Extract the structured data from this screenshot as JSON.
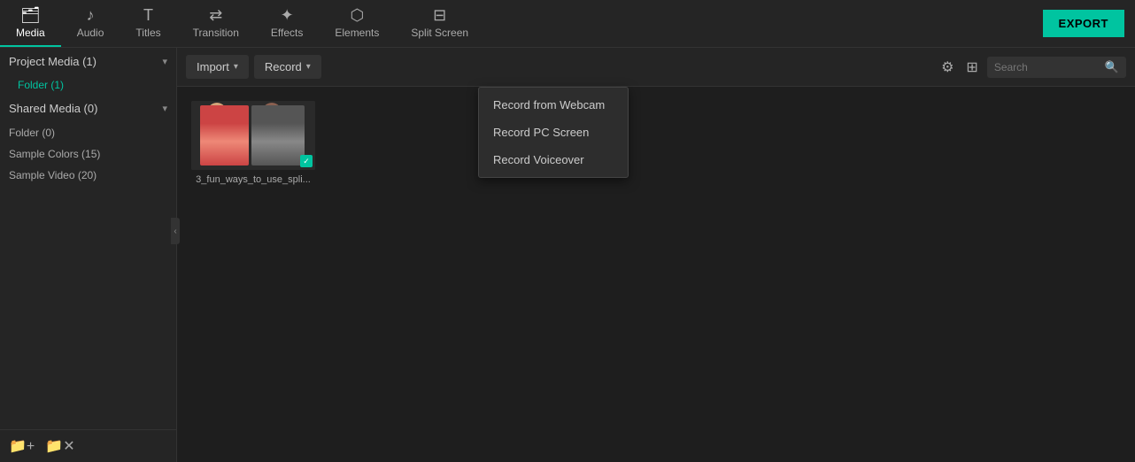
{
  "topNav": {
    "items": [
      {
        "label": "Media",
        "icon": "🗂",
        "active": true
      },
      {
        "label": "Audio",
        "icon": "♪"
      },
      {
        "label": "Titles",
        "icon": "T"
      },
      {
        "label": "Transition",
        "icon": "⇄"
      },
      {
        "label": "Effects",
        "icon": "✦"
      },
      {
        "label": "Elements",
        "icon": "⬡"
      },
      {
        "label": "Split Screen",
        "icon": "⊟"
      }
    ],
    "exportLabel": "EXPORT"
  },
  "sidebar": {
    "sections": [
      {
        "label": "Project Media (1)",
        "expanded": true,
        "subItems": [
          "Folder (1)"
        ]
      },
      {
        "label": "Shared Media (0)",
        "expanded": true,
        "subItems": [
          "Folder (0)"
        ]
      }
    ],
    "items": [
      "Sample Colors (15)",
      "Sample Video (20)"
    ],
    "footer": {
      "addFolderLabel": "Add Folder",
      "removeFolderLabel": "Remove Folder"
    }
  },
  "toolbar": {
    "importLabel": "Import",
    "recordLabel": "Record",
    "filterTitle": "Filter",
    "gridTitle": "Grid View",
    "searchPlaceholder": "Search"
  },
  "dropdown": {
    "items": [
      "Record from Webcam",
      "Record PC Screen",
      "Record Voiceover"
    ]
  },
  "mediaGrid": {
    "items": [
      {
        "label": "3_fun_ways_to_use_spli...",
        "checked": true
      }
    ]
  }
}
